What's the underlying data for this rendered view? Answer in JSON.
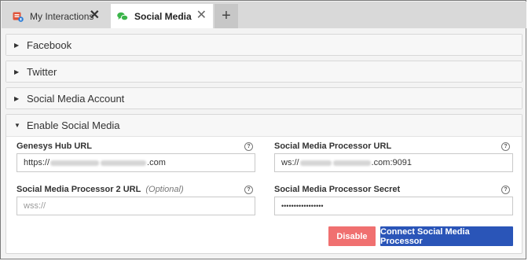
{
  "tabs": [
    {
      "label": "My Interactions",
      "close": "✕"
    },
    {
      "label": "Social Media",
      "close": "✕"
    }
  ],
  "add_tab": "+",
  "sections": [
    {
      "label": "Facebook",
      "expanded": false
    },
    {
      "label": "Twitter",
      "expanded": false
    },
    {
      "label": "Social Media Account",
      "expanded": false
    },
    {
      "label": "Enable Social Media",
      "expanded": true
    }
  ],
  "form": {
    "hub_url": {
      "label": "Genesys Hub URL",
      "prefix": "https://",
      "suffix": ".com"
    },
    "processor_url": {
      "label": "Social Media Processor URL",
      "prefix": "ws://",
      "suffix": ".com:9091"
    },
    "processor2_url": {
      "label": "Social Media Processor 2 URL",
      "optional": "(Optional)",
      "placeholder": "wss://"
    },
    "processor_secret": {
      "label": "Social Media Processor Secret",
      "value": "•••••••••••••••••"
    },
    "help_glyph": "?"
  },
  "buttons": {
    "disable": "Disable",
    "connect": "Connect Social Media Processor"
  },
  "colors": {
    "disable_bg": "#f07070",
    "connect_bg": "#2a55b8",
    "active_tab_bg": "#ffffff",
    "tabbar_bg": "#d9d9d9"
  }
}
